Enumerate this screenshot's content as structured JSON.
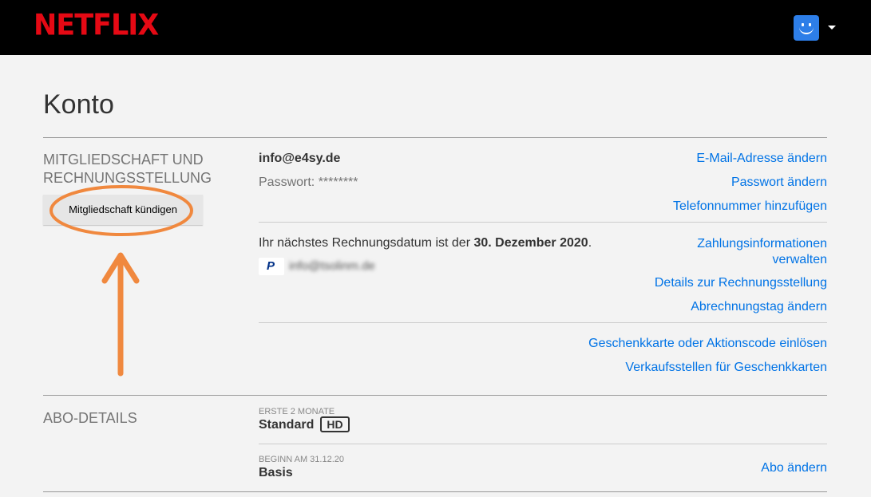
{
  "header": {
    "logo_text": "NETFLIX",
    "avatar_icon": "profile-avatar-icon",
    "menu_icon": "caret-down-icon"
  },
  "page": {
    "title": "Konto"
  },
  "membership": {
    "section_label_line1": "MITGLIEDSCHAFT UND",
    "section_label_line2": "RECHNUNGSSTELLUNG",
    "cancel_button": "Mitgliedschaft kündigen",
    "email": "info@e4sy.de",
    "password": "Passwort: ********",
    "links_account": [
      "E-Mail-Adresse ändern",
      "Passwort ändern",
      "Telefonnummer hinzufügen"
    ],
    "billing_prefix": "Ihr nächstes Rechnungsdatum ist der ",
    "billing_date": "30. Dezember 2020",
    "billing_suffix": ".",
    "payment_method_icon": "paypal-icon",
    "payment_account_redacted": "info@tsolinm.de",
    "payment_link_line1": "Zahlungsinformationen",
    "payment_link_line2": "verwalten",
    "billing_links": [
      "Details zur Rechnungsstellung",
      "Abrechnungstag ändern"
    ],
    "gift_links": [
      "Geschenkkarte oder Aktionscode einlösen",
      "Verkaufsstellen für Geschenkkarten"
    ]
  },
  "plan": {
    "section_label": "ABO-DETAILS",
    "current_caption": "ERSTE 2 MONATE",
    "current_plan": "Standard",
    "current_badge": "HD",
    "next_caption": "BEGINN AM 31.12.20",
    "next_plan": "Basis",
    "change_link": "Abo ändern"
  },
  "annotation": {
    "color": "#f0883e",
    "highlight": "ellipse-around-cancel-button",
    "arrow_icon": "arrow-up-icon"
  }
}
